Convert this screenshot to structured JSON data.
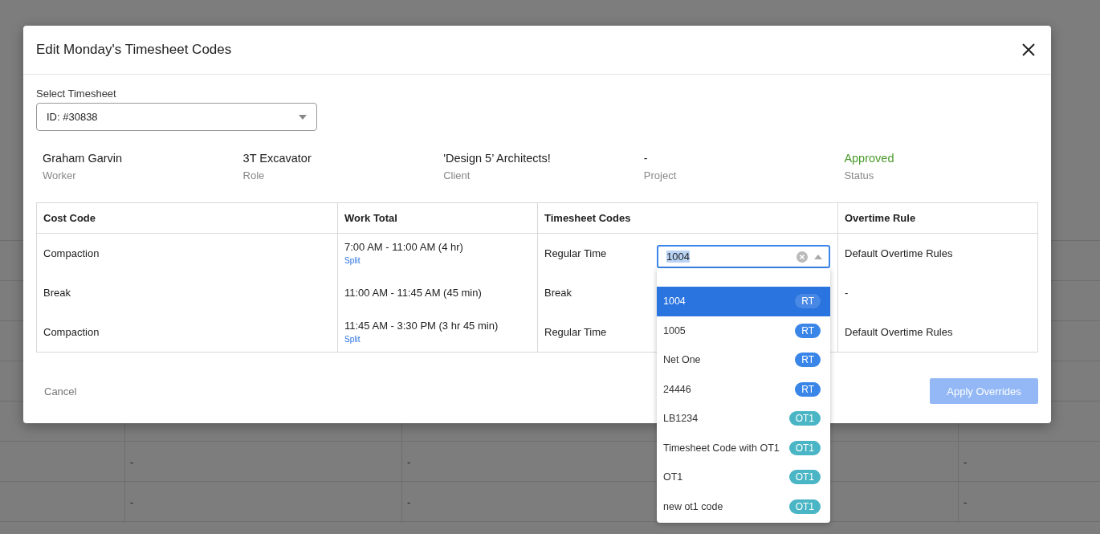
{
  "background_table": {
    "rows": [
      [
        "-",
        "-",
        "-"
      ],
      [
        "-",
        "-",
        "-"
      ]
    ]
  },
  "dialog": {
    "title": "Edit Monday's Timesheet Codes",
    "timesheet_select": {
      "label": "Select Timesheet",
      "value": "ID: #30838"
    },
    "details": [
      {
        "value": "Graham Garvin",
        "label": "Worker",
        "kind": "plain"
      },
      {
        "value": "3T Excavator",
        "label": "Role",
        "kind": "plain"
      },
      {
        "value": "'Design 5’ Architects!",
        "label": "Client",
        "kind": "plain"
      },
      {
        "value": "-",
        "label": "Project",
        "kind": "plain"
      },
      {
        "value": "Approved",
        "label": "Status",
        "kind": "status"
      }
    ],
    "table": {
      "columns": [
        "Cost Code",
        "Work Total",
        "Timesheet Codes",
        "Overtime Rule"
      ],
      "rows": [
        {
          "cost_code": "Compaction",
          "work_total": "7:00 AM - 11:00 AM (4 hr)",
          "split_link": "Split",
          "timesheet_code": "Regular Time",
          "overtime_rule": "Default Overtime Rules"
        },
        {
          "cost_code": "Break",
          "work_total": "11:00 AM - 11:45 AM (45 min)",
          "timesheet_code": "Break",
          "overtime_rule": "-"
        },
        {
          "cost_code": "Compaction",
          "work_total": "11:45 AM - 3:30 PM (3 hr 45 min)",
          "split_link": "Split",
          "timesheet_code": "Regular Time",
          "overtime_rule": "Default Overtime Rules"
        }
      ]
    },
    "code_dropdown": {
      "value": "1004",
      "options": [
        {
          "label": "1004",
          "tag": "RT",
          "selected": true
        },
        {
          "label": "1005",
          "tag": "RT",
          "selected": false
        },
        {
          "label": "Net One",
          "tag": "RT",
          "selected": false
        },
        {
          "label": "24446",
          "tag": "RT",
          "selected": false
        },
        {
          "label": "LB1234",
          "tag": "OT1",
          "selected": false
        },
        {
          "label": "Timesheet Code with OT1",
          "tag": "OT1",
          "selected": false
        },
        {
          "label": "OT1",
          "tag": "OT1",
          "selected": false
        },
        {
          "label": "new ot1 code",
          "tag": "OT1",
          "selected": false
        }
      ]
    },
    "cancel_button": "Cancel",
    "apply_button": {
      "label": "Apply Overrides",
      "disabled": true
    }
  }
}
